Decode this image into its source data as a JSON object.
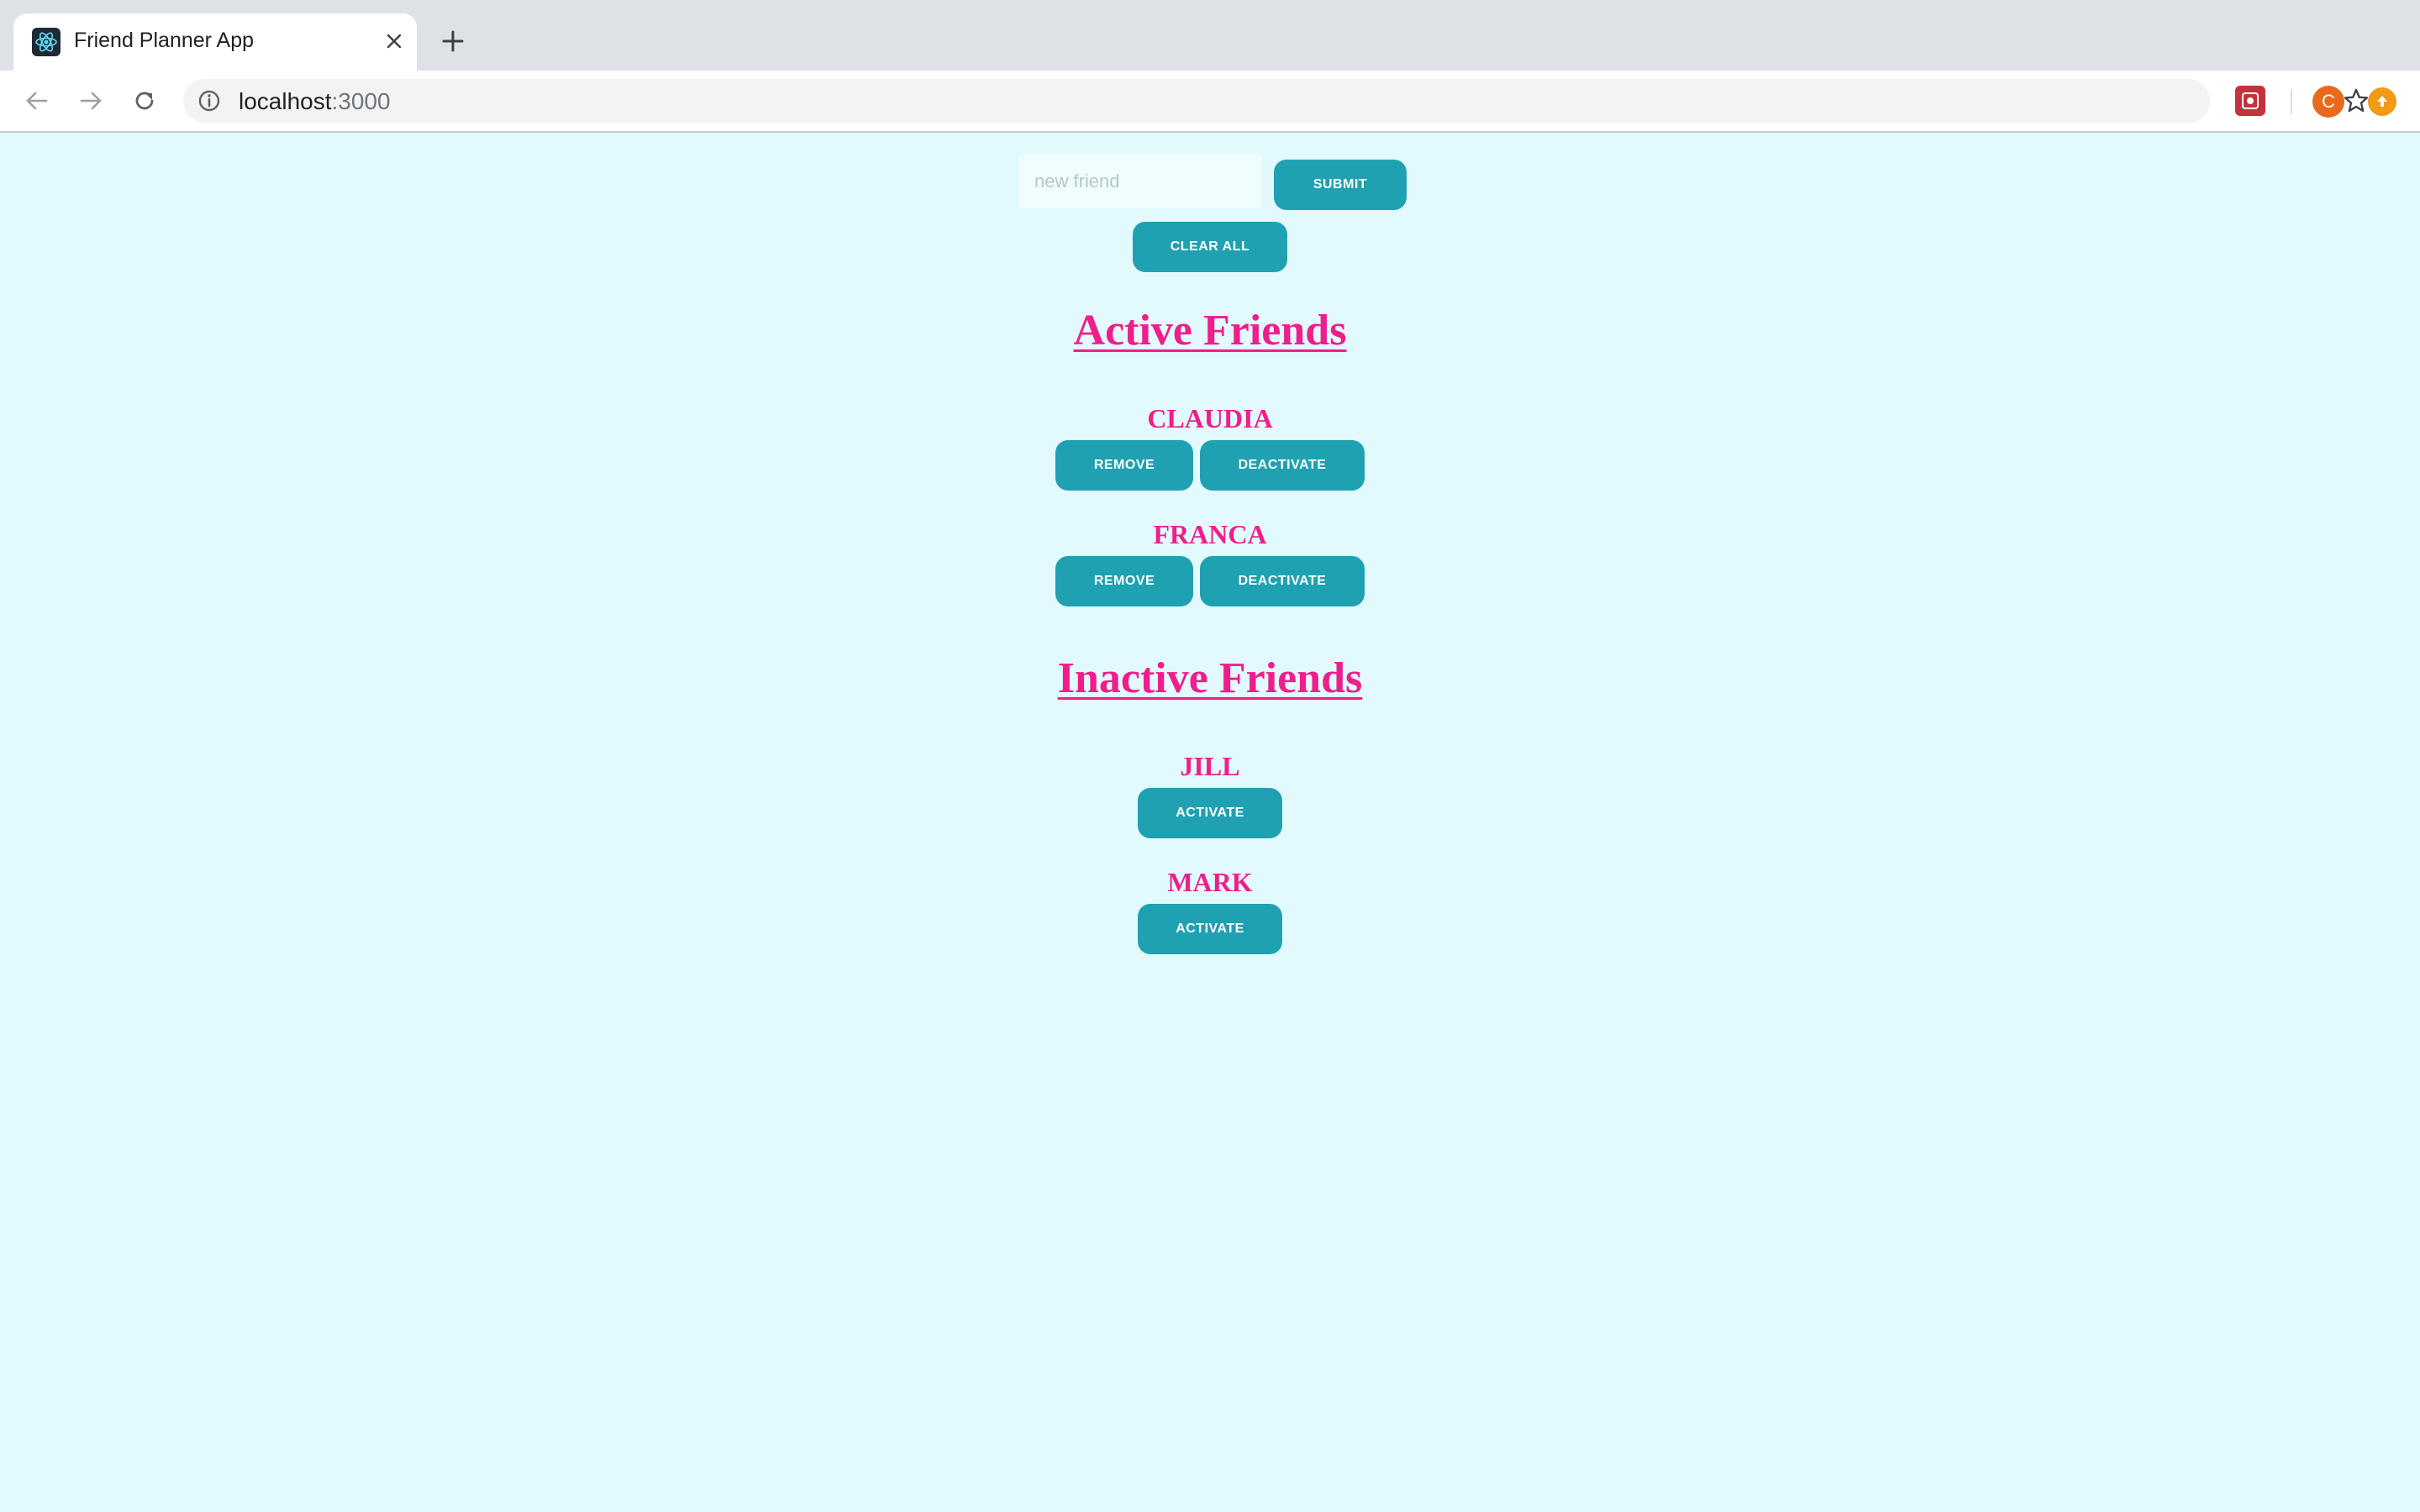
{
  "browser": {
    "tab_title": "Friend Planner App",
    "url_host": "localhost",
    "url_port": ":3000",
    "profile_initial": "C"
  },
  "form": {
    "input_placeholder": "new friend",
    "input_value": "",
    "submit_label": "SUBMIT",
    "clear_all_label": "CLEAR ALL"
  },
  "active_section": {
    "title": "Active Friends",
    "friends": [
      {
        "name": "CLAUDIA",
        "remove_label": "REMOVE",
        "deactivate_label": "DEACTIVATE"
      },
      {
        "name": "FRANCA",
        "remove_label": "REMOVE",
        "deactivate_label": "DEACTIVATE"
      }
    ]
  },
  "inactive_section": {
    "title": "Inactive Friends",
    "friends": [
      {
        "name": "JILL",
        "activate_label": "ACTIVATE"
      },
      {
        "name": "MARK",
        "activate_label": "ACTIVATE"
      }
    ]
  },
  "colors": {
    "page_background": "#e2fafd",
    "button": "#1fa1b2",
    "heading": "#ef1e8c"
  },
  "icons": {
    "favicon": "react-logo-icon",
    "tab_close": "close-icon",
    "new_tab": "plus-icon",
    "back": "arrow-left-icon",
    "forward": "arrow-right-icon",
    "reload": "reload-icon",
    "site_info": "info-icon",
    "bookmark": "star-icon",
    "extension": "extension-icon",
    "update": "update-icon"
  }
}
